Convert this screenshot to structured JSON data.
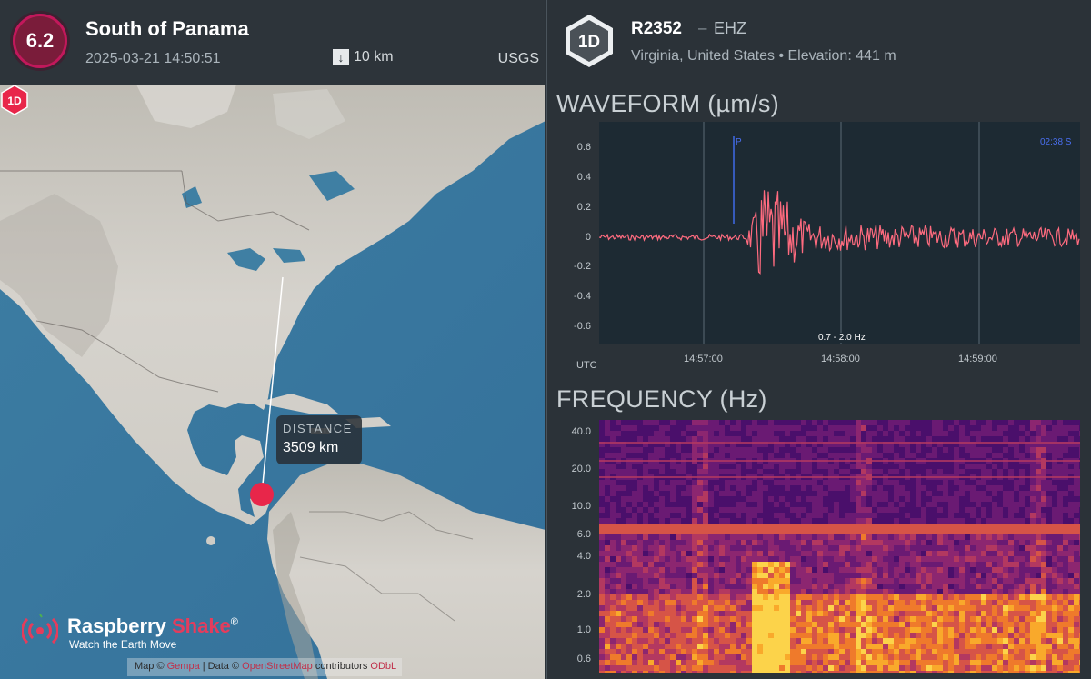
{
  "earthquake": {
    "magnitude": "6.2",
    "title": "South of Panama",
    "datetime": "2025-03-21 14:50:51",
    "depth": "10 km",
    "source": "USGS"
  },
  "map": {
    "station_marker": "1D",
    "distance_label": "DISTANCE",
    "distance_value": "3509 km",
    "logo_name_part1": "Raspberry",
    "logo_name_part2": "Shake",
    "logo_reg": "®",
    "logo_tagline": "Watch the Earth Move",
    "attribution_prefix": "Map ©",
    "attribution_link1": "Gempa",
    "attribution_mid": " | Data ©",
    "attribution_link2": "OpenStreetMap",
    "attribution_suffix": " contributors ",
    "attribution_link3": "ODbL",
    "icons": [
      "depth-arrow-icon",
      "raspberry-shake-logo-icon",
      "station-hexagon-icon",
      "epicenter-marker"
    ]
  },
  "station": {
    "badge": "1D",
    "code": "R2352",
    "separator": "–",
    "channel": "EHZ",
    "location": "Virginia, United States • Elevation: 441 m"
  },
  "waveform": {
    "title": "WAVEFORM (µm/s)",
    "y_ticks": [
      "0.6",
      "0.4",
      "0.2",
      "0",
      "-0.2",
      "-0.4",
      "-0.6"
    ],
    "x_ticks": [
      "14:57:00",
      "14:58:00",
      "14:59:00"
    ],
    "utc_label": "UTC",
    "filter": "0.7 - 2.0 Hz",
    "p_marker": "P",
    "end_marker": "02:38  S",
    "line_color": "#ff6b7f"
  },
  "frequency": {
    "title": "FREQUENCY (Hz)",
    "y_ticks": [
      "40.0",
      "20.0",
      "10.0",
      "6.0",
      "4.0",
      "2.0",
      "1.0",
      "0.6"
    ]
  }
}
